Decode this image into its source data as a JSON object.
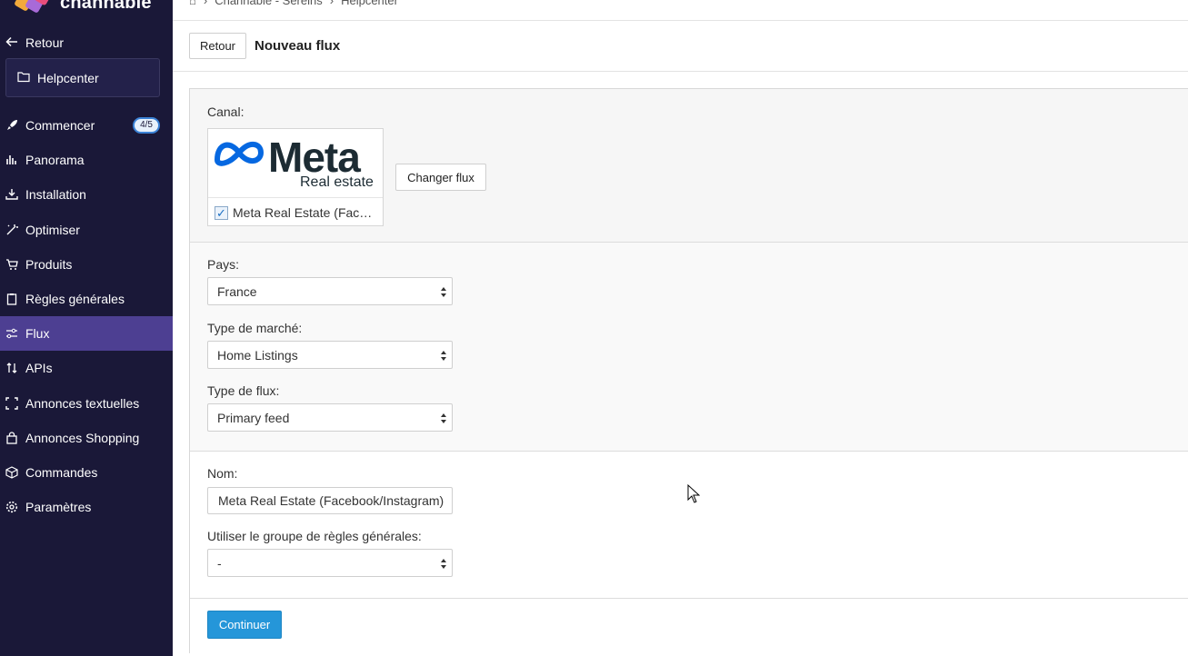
{
  "sidebar": {
    "logo_text": "channable",
    "back_label": "Retour",
    "folder_label": "Helpcenter",
    "items": [
      {
        "label": "Commencer",
        "icon": "rocket-icon",
        "badge": "4/5"
      },
      {
        "label": "Panorama",
        "icon": "bar-chart-icon"
      },
      {
        "label": "Installation",
        "icon": "download-icon"
      },
      {
        "label": "Optimiser",
        "icon": "magic-wand-icon"
      },
      {
        "label": "Produits",
        "icon": "cart-icon"
      },
      {
        "label": "Règles générales",
        "icon": "clipboard-icon"
      },
      {
        "label": "Flux",
        "icon": "sliders-icon",
        "active": true
      },
      {
        "label": "APIs",
        "icon": "arrows-updown-icon"
      },
      {
        "label": "Annonces textuelles",
        "icon": "frame-icon"
      },
      {
        "label": "Annonces Shopping",
        "icon": "shopping-bag-icon"
      },
      {
        "label": "Commandes",
        "icon": "box-icon"
      },
      {
        "label": "Paramètres",
        "icon": "gear-icon"
      }
    ]
  },
  "breadcrumb": {
    "items": [
      "Channable - Sereins",
      "Helpcenter"
    ]
  },
  "header": {
    "back_button": "Retour",
    "title": "Nouveau flux"
  },
  "form": {
    "channel_label": "Canal:",
    "channel_logo_word": "Meta",
    "channel_logo_sub": "Real estate",
    "channel_name": "Meta Real Estate (Facebook/Instagram)",
    "channel_checked": true,
    "change_button": "Changer flux",
    "country_label": "Pays:",
    "country_value": "France",
    "market_label": "Type de marché:",
    "market_value": "Home Listings",
    "feed_type_label": "Type de flux:",
    "feed_type_value": "Primary feed",
    "name_label": "Nom:",
    "name_value": "Meta Real Estate (Facebook/Instagram)",
    "rules_label": "Utiliser le groupe de règles générales:",
    "rules_value": "-",
    "continue_button": "Continuer"
  },
  "colors": {
    "sidebar_bg": "#1a1838",
    "sidebar_active": "#4d3f92",
    "primary": "#2596d9",
    "meta_blue": "#0668e1"
  }
}
